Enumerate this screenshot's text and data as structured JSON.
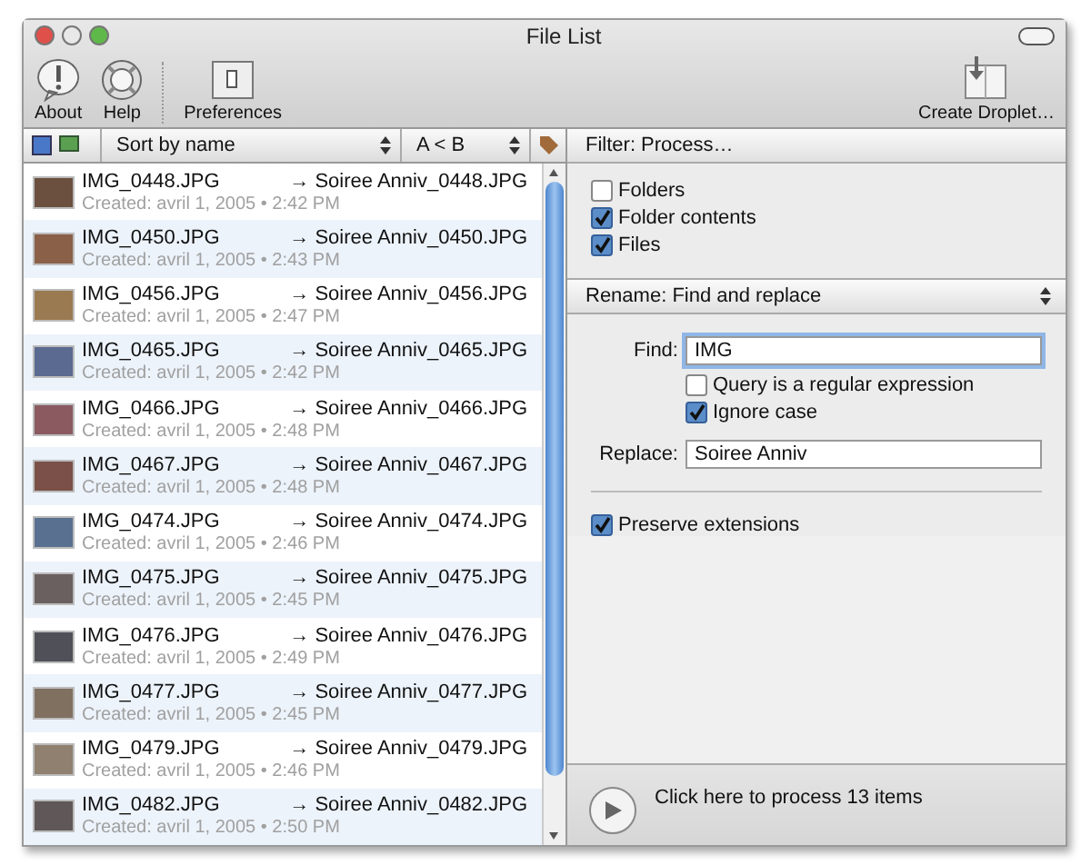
{
  "window": {
    "title": "File List"
  },
  "toolbar": {
    "items": [
      {
        "kind": "about",
        "label": "About"
      },
      {
        "kind": "help",
        "label": "Help"
      },
      {
        "kind": "preferences",
        "label": "Preferences"
      }
    ],
    "droplet": "Create Droplet…"
  },
  "list_header": {
    "sort": "Sort by name",
    "order": "A < B"
  },
  "files": [
    {
      "name": "IMG_0448.JPG",
      "created": "Created: avril 1, 2005 • 2:42 PM",
      "new_name": "→ Soiree Anniv_0448.JPG"
    },
    {
      "name": "IMG_0450.JPG",
      "created": "Created: avril 1, 2005 • 2:43 PM",
      "new_name": "→ Soiree Anniv_0450.JPG"
    },
    {
      "name": "IMG_0456.JPG",
      "created": "Created: avril 1, 2005 • 2:47 PM",
      "new_name": "→ Soiree Anniv_0456.JPG"
    },
    {
      "name": "IMG_0465.JPG",
      "created": "Created: avril 1, 2005 • 2:42 PM",
      "new_name": "→ Soiree Anniv_0465.JPG"
    },
    {
      "name": "IMG_0466.JPG",
      "created": "Created: avril 1, 2005 • 2:48 PM",
      "new_name": "→ Soiree Anniv_0466.JPG"
    },
    {
      "name": "IMG_0467.JPG",
      "created": "Created: avril 1, 2005 • 2:48 PM",
      "new_name": "→ Soiree Anniv_0467.JPG"
    },
    {
      "name": "IMG_0474.JPG",
      "created": "Created: avril 1, 2005 • 2:46 PM",
      "new_name": "→ Soiree Anniv_0474.JPG"
    },
    {
      "name": "IMG_0475.JPG",
      "created": "Created: avril 1, 2005 • 2:45 PM",
      "new_name": "→ Soiree Anniv_0475.JPG"
    },
    {
      "name": "IMG_0476.JPG",
      "created": "Created: avril 1, 2005 • 2:49 PM",
      "new_name": "→ Soiree Anniv_0476.JPG"
    },
    {
      "name": "IMG_0477.JPG",
      "created": "Created: avril 1, 2005 • 2:45 PM",
      "new_name": "→ Soiree Anniv_0477.JPG"
    },
    {
      "name": "IMG_0479.JPG",
      "created": "Created: avril 1, 2005 • 2:46 PM",
      "new_name": "→ Soiree Anniv_0479.JPG"
    },
    {
      "name": "IMG_0482.JPG",
      "created": "Created: avril 1, 2005 • 2:50 PM",
      "new_name": "→ Soiree Anniv_0482.JPG"
    }
  ],
  "filter": {
    "title": "Filter: Process…",
    "options": [
      {
        "label": "Folders",
        "checked": false
      },
      {
        "label": "Folder contents",
        "checked": true
      },
      {
        "label": "Files",
        "checked": true
      }
    ]
  },
  "rename": {
    "title": "Rename: Find and replace",
    "find_label": "Find:",
    "find_value": "IMG",
    "find_options": [
      {
        "label": "Query is a regular expression",
        "checked": false
      },
      {
        "label": "Ignore case",
        "checked": true
      }
    ],
    "replace_label": "Replace:",
    "replace_value": "Soiree Anniv",
    "preserve": {
      "label": "Preserve extensions",
      "checked": true
    }
  },
  "process": {
    "label": "Click here to process 13 items"
  }
}
